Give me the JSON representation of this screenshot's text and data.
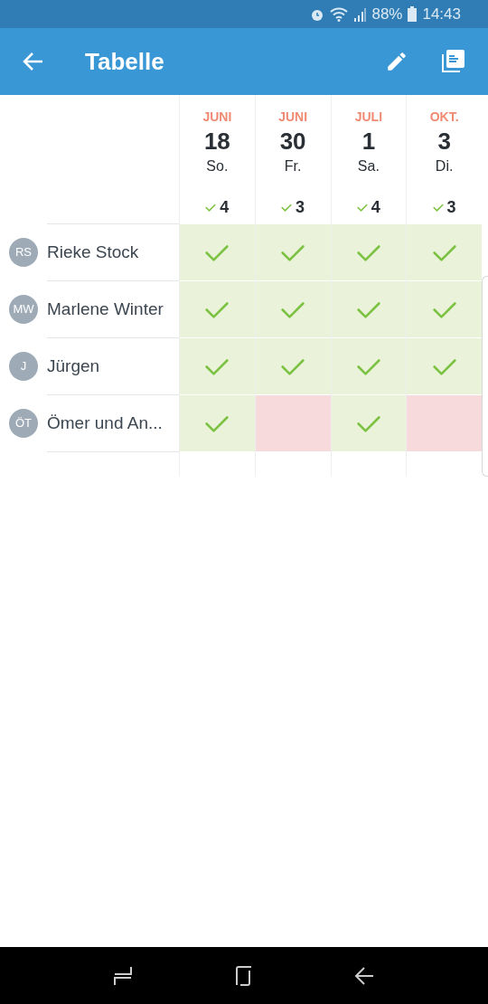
{
  "status_bar": {
    "battery": "88%",
    "time": "14:43"
  },
  "app_bar": {
    "title": "Tabelle"
  },
  "dates": [
    {
      "month": "JUNI",
      "day": "18",
      "weekday": "So.",
      "count": "4"
    },
    {
      "month": "JUNI",
      "day": "30",
      "weekday": "Fr.",
      "count": "3"
    },
    {
      "month": "JULI",
      "day": "1",
      "weekday": "Sa.",
      "count": "4"
    },
    {
      "month": "OKT.",
      "day": "3",
      "weekday": "Di.",
      "count": "3"
    }
  ],
  "participants": [
    {
      "initials": "RS",
      "name": "Rieke Stock",
      "answers": [
        {
          "kind": "yes"
        },
        {
          "kind": "yes"
        },
        {
          "kind": "yes"
        },
        {
          "kind": "yes"
        }
      ]
    },
    {
      "initials": "MW",
      "name": "Marlene Winter",
      "answers": [
        {
          "kind": "yes"
        },
        {
          "kind": "yes"
        },
        {
          "kind": "yes"
        },
        {
          "kind": "yes"
        }
      ]
    },
    {
      "initials": "J",
      "name": "Jürgen",
      "answers": [
        {
          "kind": "yes"
        },
        {
          "kind": "yes"
        },
        {
          "kind": "yes"
        },
        {
          "kind": "yes"
        }
      ]
    },
    {
      "initials": "ÖT",
      "name": "Ömer und An...",
      "answers": [
        {
          "kind": "yes"
        },
        {
          "kind": "no"
        },
        {
          "kind": "yes"
        },
        {
          "kind": "no"
        }
      ]
    }
  ]
}
